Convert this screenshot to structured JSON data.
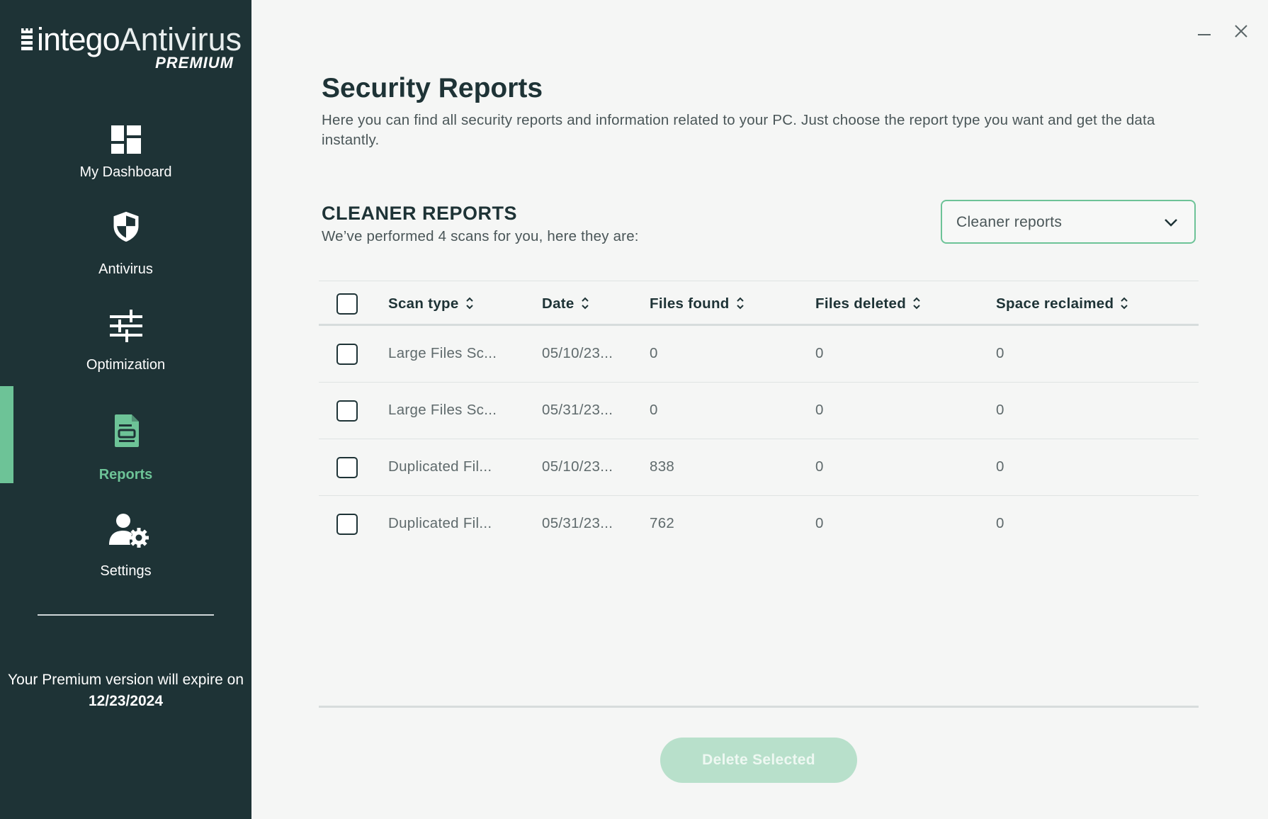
{
  "brand": {
    "name_part1": "intego",
    "name_part2": "Antivirus",
    "tier": "PREMIUM"
  },
  "sidebar": {
    "items": [
      {
        "label": "My Dashboard",
        "icon": "dashboard-icon"
      },
      {
        "label": "Antivirus",
        "icon": "shield-icon"
      },
      {
        "label": "Optimization",
        "icon": "sliders-icon"
      },
      {
        "label": "Reports",
        "icon": "report-document-icon",
        "active": true
      },
      {
        "label": "Settings",
        "icon": "user-gear-icon"
      }
    ],
    "expiry_prefix": "Your Premium version will expire on",
    "expiry_date": "12/23/2024"
  },
  "window": {
    "minimize": "minimize-icon",
    "close": "close-icon"
  },
  "page": {
    "title": "Security Reports",
    "subtitle": "Here you can find all security reports and information related to your PC. Just choose the report type you want and get the data instantly."
  },
  "section": {
    "title": "CLEANER REPORTS",
    "subtitle": "We’ve performed 4 scans for you, here they are:",
    "dropdown_value": "Cleaner reports"
  },
  "table": {
    "columns": [
      "Scan type",
      "Date",
      "Files found",
      "Files deleted",
      "Space reclaimed"
    ],
    "rows": [
      {
        "scan_type": "Large Files Sc...",
        "date": "05/10/23...",
        "files_found": "0",
        "files_deleted": "0",
        "space_reclaimed": "0"
      },
      {
        "scan_type": "Large Files Sc...",
        "date": "05/31/23...",
        "files_found": "0",
        "files_deleted": "0",
        "space_reclaimed": "0"
      },
      {
        "scan_type": "Duplicated Fil...",
        "date": "05/10/23...",
        "files_found": "838",
        "files_deleted": "0",
        "space_reclaimed": "0"
      },
      {
        "scan_type": "Duplicated Fil...",
        "date": "05/31/23...",
        "files_found": "762",
        "files_deleted": "0",
        "space_reclaimed": "0"
      }
    ]
  },
  "actions": {
    "delete_label": "Delete Selected"
  },
  "colors": {
    "sidebar": "#1e3336",
    "accent": "#6dc397",
    "button_disabled": "#b8e0cb"
  }
}
